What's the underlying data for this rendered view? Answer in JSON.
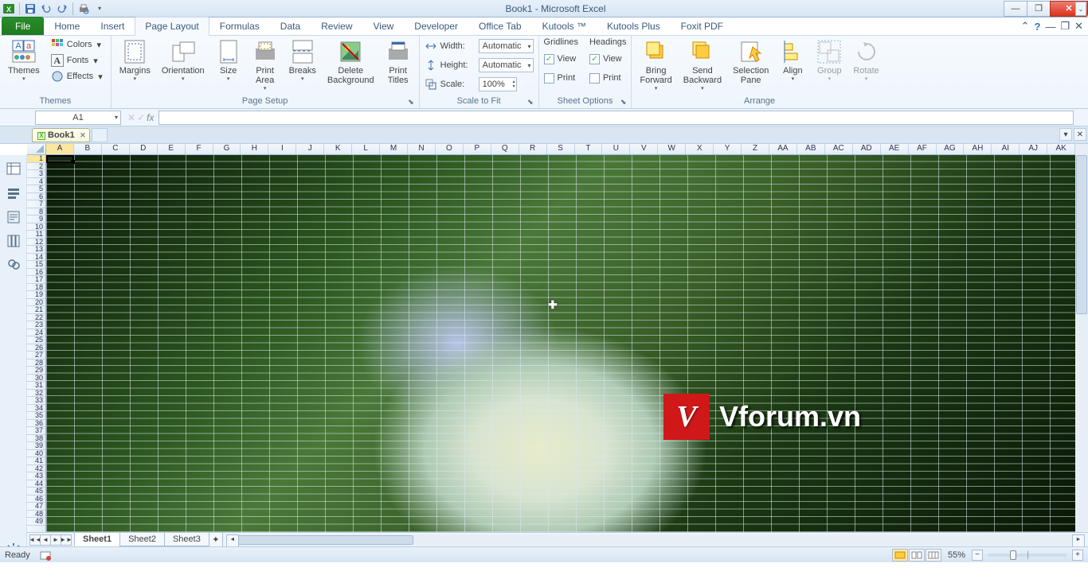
{
  "app": {
    "title": "Book1 - Microsoft Excel"
  },
  "tabs": {
    "file": "File",
    "home": "Home",
    "insert": "Insert",
    "pagelayout": "Page Layout",
    "formulas": "Formulas",
    "data": "Data",
    "review": "Review",
    "view": "View",
    "developer": "Developer",
    "officetab": "Office Tab",
    "kutools": "Kutools ™",
    "kutoolsplus": "Kutools Plus",
    "foxit": "Foxit PDF"
  },
  "ribbon": {
    "themes": {
      "group": "Themes",
      "themes": "Themes",
      "colors": "Colors",
      "fonts": "Fonts",
      "effects": "Effects"
    },
    "pagesetup": {
      "group": "Page Setup",
      "margins": "Margins",
      "orientation": "Orientation",
      "size": "Size",
      "printarea": "Print\nArea",
      "breaks": "Breaks",
      "background": "Delete\nBackground",
      "titles": "Print\nTitles"
    },
    "scale": {
      "group": "Scale to Fit",
      "width": "Width:",
      "height": "Height:",
      "scale": "Scale:",
      "auto": "Automatic",
      "pct": "100%"
    },
    "sheet": {
      "group": "Sheet Options",
      "gridlines": "Gridlines",
      "headings": "Headings",
      "view": "View",
      "print": "Print"
    },
    "arrange": {
      "group": "Arrange",
      "forward": "Bring\nForward",
      "backward": "Send\nBackward",
      "selpane": "Selection\nPane",
      "align": "Align",
      "group2": "Group",
      "rotate": "Rotate"
    }
  },
  "formula": {
    "cellref": "A1",
    "fx": "fx",
    "value": ""
  },
  "workbook": {
    "tab1": "Book1"
  },
  "columns": [
    "A",
    "B",
    "C",
    "D",
    "E",
    "F",
    "G",
    "H",
    "I",
    "J",
    "K",
    "L",
    "M",
    "N",
    "O",
    "P",
    "Q",
    "R",
    "S",
    "T",
    "U",
    "V",
    "W",
    "X",
    "Y",
    "Z",
    "AA",
    "AB",
    "AC",
    "AD",
    "AE",
    "AF",
    "AG",
    "AH",
    "AI",
    "AJ",
    "AK"
  ],
  "rowcount": 49,
  "watermark": {
    "badge": "V",
    "text": "Vforum.vn"
  },
  "sheets": {
    "s1": "Sheet1",
    "s2": "Sheet2",
    "s3": "Sheet3"
  },
  "status": {
    "ready": "Ready",
    "zoom": "55%"
  }
}
